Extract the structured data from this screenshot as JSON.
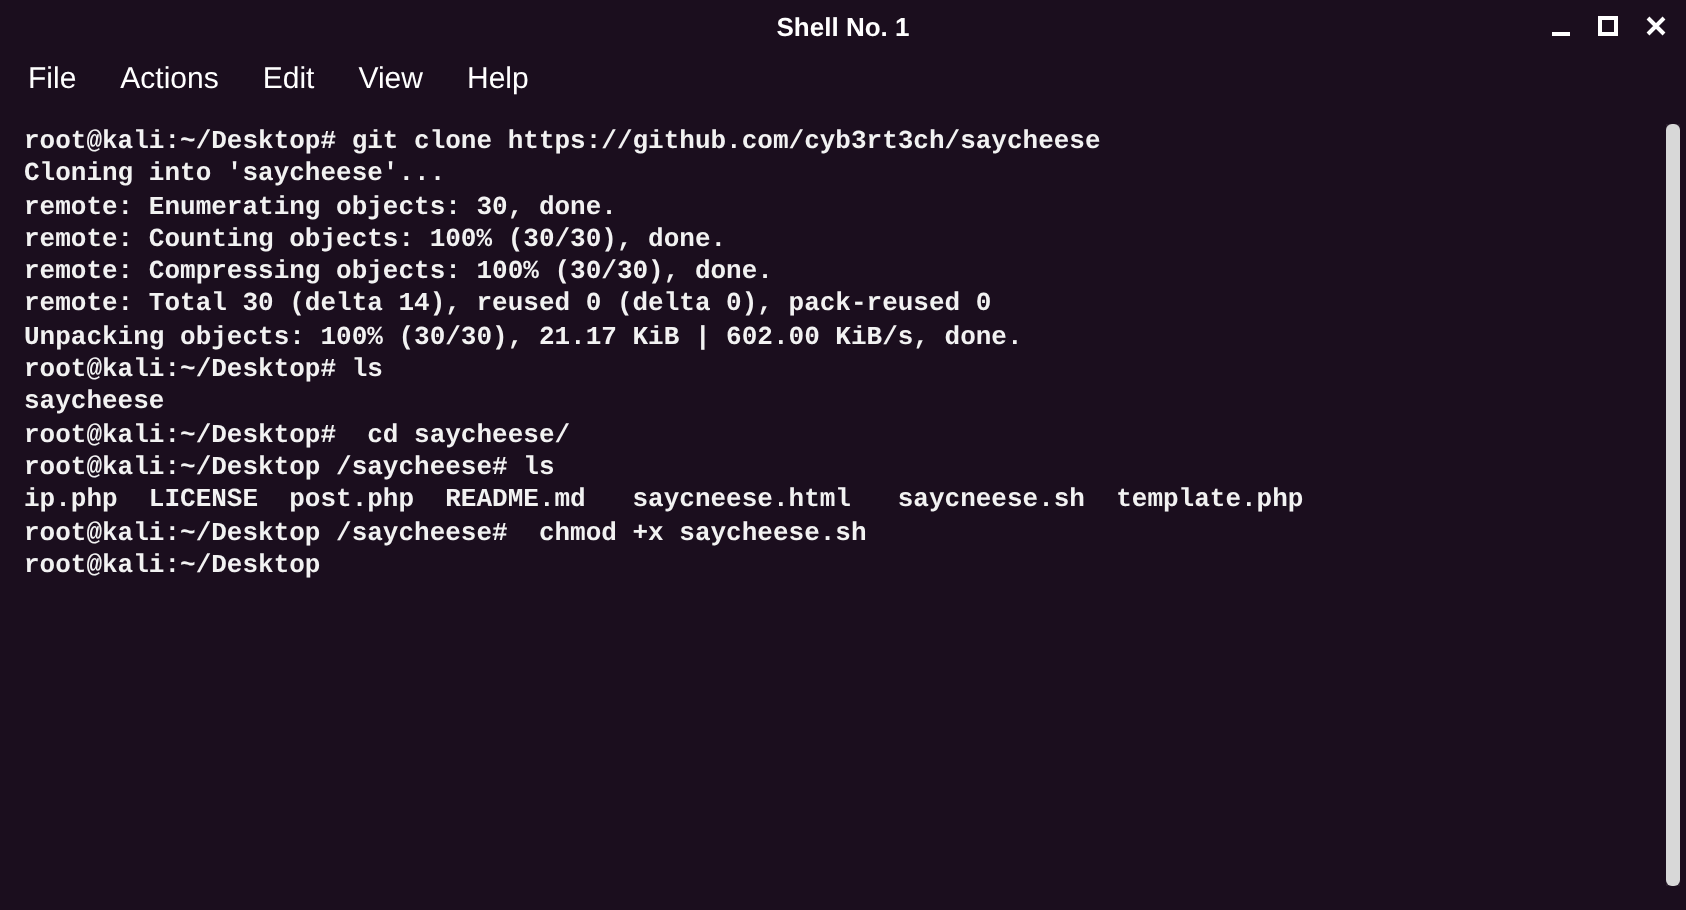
{
  "window": {
    "title": "Shell No. 1"
  },
  "menu": [
    "File",
    "Actions",
    "Edit",
    "View",
    "Help"
  ],
  "terminal": {
    "lines": [
      "root@kali:~/Desktop# git clone https://github.com/cyb3rt3ch/saycheese",
      "Cloning into 'saycheese'...",
      "remote: Enumerating objects: 30, done.",
      "remote: Counting objects: 100% (30/30), done.",
      "remote: Compressing objects: 100% (30/30), done.",
      "remote: Total 30 (delta 14), reused 0 (delta 0), pack-reused 0",
      "Unpacking objects: 100% (30/30), 21.17 KiB | 602.00 KiB/s, done.",
      "root@kali:~/Desktop# ls",
      "saycheese",
      "root@kali:~/Desktop#  cd saycheese/",
      "root@kali:~/Desktop /saycheese# ls",
      "ip.php  LICENSE  post.php  README.md   saycneese.html   saycneese.sh  template.php",
      "root@kali:~/Desktop /saycheese#  chmod +x saycheese.sh",
      "root@kali:~/Desktop"
    ]
  }
}
